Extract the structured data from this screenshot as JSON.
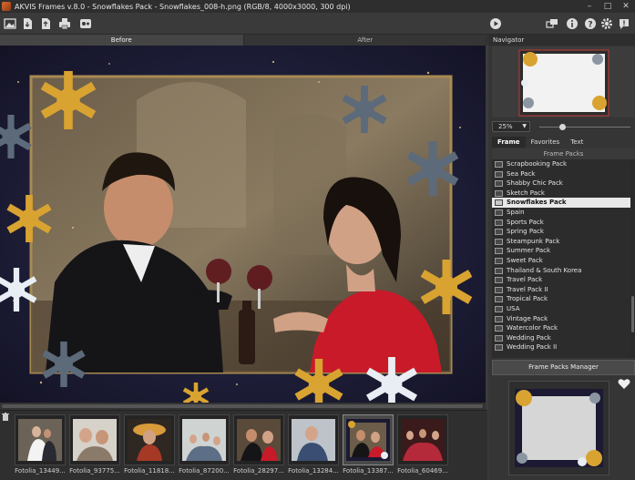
{
  "window": {
    "title": "AKVIS Frames v.8.0 - Snowflakes Pack - Snowflakes_008-h.png (RGB/8, 4000x3000, 300 dpi)",
    "controls": [
      "–",
      "□",
      "✕"
    ]
  },
  "toolbar": {
    "left_icons": [
      "image-icon",
      "open-file-icon",
      "save-file-icon",
      "print-icon",
      "share-icon"
    ],
    "right_icons": [
      "play-icon",
      "batch-icon",
      "info-icon",
      "help-icon",
      "settings-icon",
      "notification-icon"
    ]
  },
  "view_tabs": [
    {
      "label": "Before",
      "active": true
    },
    {
      "label": "After",
      "active": false
    }
  ],
  "navigator": {
    "title": "Navigator",
    "zoom": "25%",
    "zoom_level": 0.25
  },
  "panel_tabs": [
    {
      "label": "Frame",
      "active": true
    },
    {
      "label": "Favorites",
      "active": false
    },
    {
      "label": "Text",
      "active": false
    }
  ],
  "frame_packs": {
    "header": "Frame Packs",
    "items": [
      "Scrapbooking Pack",
      "Sea Pack",
      "Shabby Chic Pack",
      "Sketch Pack",
      "Snowflakes Pack",
      "Spain",
      "Sports Pack",
      "Spring Pack",
      "Steampunk Pack",
      "Summer Pack",
      "Sweet Pack",
      "Thailand & South Korea",
      "Travel Pack",
      "Travel Pack II",
      "Tropical Pack",
      "USA",
      "Vintage Pack",
      "Watercolor Pack",
      "Wedding Pack",
      "Wedding Pack II"
    ],
    "selected": "Snowflakes Pack",
    "manager_button": "Frame Packs Manager"
  },
  "filmstrip": [
    {
      "label": "Fotolia_13449...",
      "selected": false
    },
    {
      "label": "Fotolia_93775...",
      "selected": false
    },
    {
      "label": "Fotolia_11818...",
      "selected": false
    },
    {
      "label": "Fotolia_87200...",
      "selected": false
    },
    {
      "label": "Fotolia_28297...",
      "selected": false
    },
    {
      "label": "Fotolia_13284...",
      "selected": false
    },
    {
      "label": "Fotolia_13387...",
      "selected": true
    },
    {
      "label": "Fotolia_60469...",
      "selected": false
    }
  ],
  "colors": {
    "background": "#3c3c3c",
    "panel": "#353535",
    "canvas_bg": "#1c1a33",
    "gold": "#d9a331",
    "snow": "#e8eef3",
    "selection": "#e8e8e8"
  }
}
